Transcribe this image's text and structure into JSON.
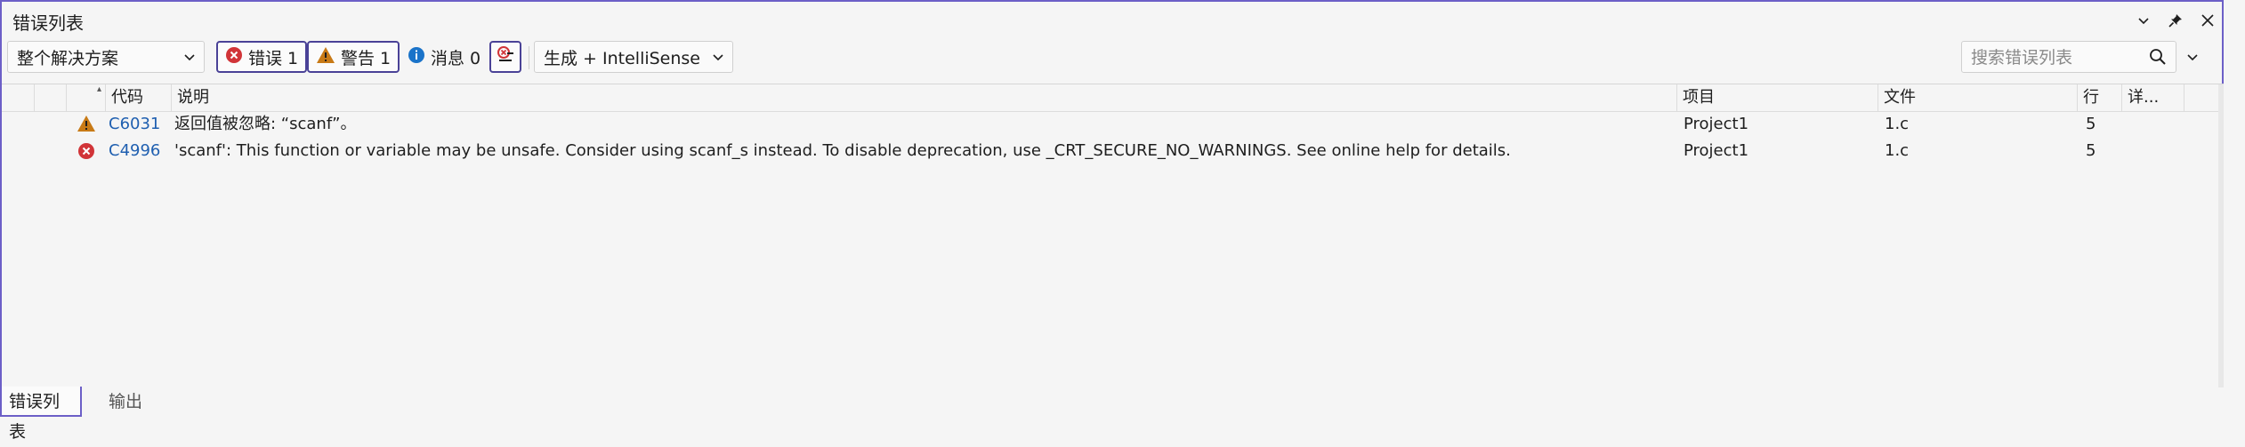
{
  "panel": {
    "title": "错误列表"
  },
  "toolbar": {
    "scope_selected": "整个解决方案",
    "errors_label": "错误 1",
    "warnings_label": "警告 1",
    "messages_label": "消息 0",
    "build_source_selected": "生成 + IntelliSense",
    "search_placeholder": "搜索错误列表"
  },
  "columns": {
    "code": "代码",
    "description": "说明",
    "project": "项目",
    "file": "文件",
    "line": "行",
    "detail": "详..."
  },
  "rows": [
    {
      "severity": "warning",
      "code": "C6031",
      "description": "返回值被忽略: “scanf”。",
      "project": "Project1",
      "file": "1.c",
      "line": "5"
    },
    {
      "severity": "error",
      "code": "C4996",
      "description": "'scanf': This function or variable may be unsafe. Consider using scanf_s instead. To disable deprecation, use _CRT_SECURE_NO_WARNINGS. See online help for details.",
      "project": "Project1",
      "file": "1.c",
      "line": "5"
    }
  ],
  "tabs": [
    {
      "label": "错误列表"
    },
    {
      "label": "输出"
    }
  ],
  "colors": {
    "accent_border": "#6c5fc7",
    "error_red": "#d13438",
    "warning_orange": "#c87a16",
    "info_blue": "#1a73c9",
    "code_link": "#1f5fb0"
  }
}
